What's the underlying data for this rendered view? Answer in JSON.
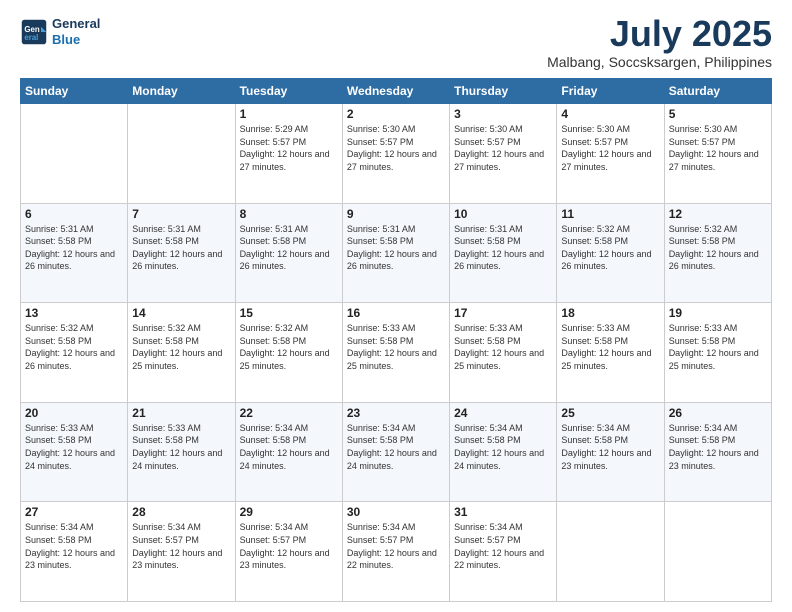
{
  "header": {
    "logo_line1": "General",
    "logo_line2": "Blue",
    "month": "July 2025",
    "location": "Malbang, Soccsksargen, Philippines"
  },
  "weekdays": [
    "Sunday",
    "Monday",
    "Tuesday",
    "Wednesday",
    "Thursday",
    "Friday",
    "Saturday"
  ],
  "weeks": [
    [
      {
        "day": "",
        "sunrise": "",
        "sunset": "",
        "daylight": ""
      },
      {
        "day": "",
        "sunrise": "",
        "sunset": "",
        "daylight": ""
      },
      {
        "day": "1",
        "sunrise": "Sunrise: 5:29 AM",
        "sunset": "Sunset: 5:57 PM",
        "daylight": "Daylight: 12 hours and 27 minutes."
      },
      {
        "day": "2",
        "sunrise": "Sunrise: 5:30 AM",
        "sunset": "Sunset: 5:57 PM",
        "daylight": "Daylight: 12 hours and 27 minutes."
      },
      {
        "day": "3",
        "sunrise": "Sunrise: 5:30 AM",
        "sunset": "Sunset: 5:57 PM",
        "daylight": "Daylight: 12 hours and 27 minutes."
      },
      {
        "day": "4",
        "sunrise": "Sunrise: 5:30 AM",
        "sunset": "Sunset: 5:57 PM",
        "daylight": "Daylight: 12 hours and 27 minutes."
      },
      {
        "day": "5",
        "sunrise": "Sunrise: 5:30 AM",
        "sunset": "Sunset: 5:57 PM",
        "daylight": "Daylight: 12 hours and 27 minutes."
      }
    ],
    [
      {
        "day": "6",
        "sunrise": "Sunrise: 5:31 AM",
        "sunset": "Sunset: 5:58 PM",
        "daylight": "Daylight: 12 hours and 26 minutes."
      },
      {
        "day": "7",
        "sunrise": "Sunrise: 5:31 AM",
        "sunset": "Sunset: 5:58 PM",
        "daylight": "Daylight: 12 hours and 26 minutes."
      },
      {
        "day": "8",
        "sunrise": "Sunrise: 5:31 AM",
        "sunset": "Sunset: 5:58 PM",
        "daylight": "Daylight: 12 hours and 26 minutes."
      },
      {
        "day": "9",
        "sunrise": "Sunrise: 5:31 AM",
        "sunset": "Sunset: 5:58 PM",
        "daylight": "Daylight: 12 hours and 26 minutes."
      },
      {
        "day": "10",
        "sunrise": "Sunrise: 5:31 AM",
        "sunset": "Sunset: 5:58 PM",
        "daylight": "Daylight: 12 hours and 26 minutes."
      },
      {
        "day": "11",
        "sunrise": "Sunrise: 5:32 AM",
        "sunset": "Sunset: 5:58 PM",
        "daylight": "Daylight: 12 hours and 26 minutes."
      },
      {
        "day": "12",
        "sunrise": "Sunrise: 5:32 AM",
        "sunset": "Sunset: 5:58 PM",
        "daylight": "Daylight: 12 hours and 26 minutes."
      }
    ],
    [
      {
        "day": "13",
        "sunrise": "Sunrise: 5:32 AM",
        "sunset": "Sunset: 5:58 PM",
        "daylight": "Daylight: 12 hours and 26 minutes."
      },
      {
        "day": "14",
        "sunrise": "Sunrise: 5:32 AM",
        "sunset": "Sunset: 5:58 PM",
        "daylight": "Daylight: 12 hours and 25 minutes."
      },
      {
        "day": "15",
        "sunrise": "Sunrise: 5:32 AM",
        "sunset": "Sunset: 5:58 PM",
        "daylight": "Daylight: 12 hours and 25 minutes."
      },
      {
        "day": "16",
        "sunrise": "Sunrise: 5:33 AM",
        "sunset": "Sunset: 5:58 PM",
        "daylight": "Daylight: 12 hours and 25 minutes."
      },
      {
        "day": "17",
        "sunrise": "Sunrise: 5:33 AM",
        "sunset": "Sunset: 5:58 PM",
        "daylight": "Daylight: 12 hours and 25 minutes."
      },
      {
        "day": "18",
        "sunrise": "Sunrise: 5:33 AM",
        "sunset": "Sunset: 5:58 PM",
        "daylight": "Daylight: 12 hours and 25 minutes."
      },
      {
        "day": "19",
        "sunrise": "Sunrise: 5:33 AM",
        "sunset": "Sunset: 5:58 PM",
        "daylight": "Daylight: 12 hours and 25 minutes."
      }
    ],
    [
      {
        "day": "20",
        "sunrise": "Sunrise: 5:33 AM",
        "sunset": "Sunset: 5:58 PM",
        "daylight": "Daylight: 12 hours and 24 minutes."
      },
      {
        "day": "21",
        "sunrise": "Sunrise: 5:33 AM",
        "sunset": "Sunset: 5:58 PM",
        "daylight": "Daylight: 12 hours and 24 minutes."
      },
      {
        "day": "22",
        "sunrise": "Sunrise: 5:34 AM",
        "sunset": "Sunset: 5:58 PM",
        "daylight": "Daylight: 12 hours and 24 minutes."
      },
      {
        "day": "23",
        "sunrise": "Sunrise: 5:34 AM",
        "sunset": "Sunset: 5:58 PM",
        "daylight": "Daylight: 12 hours and 24 minutes."
      },
      {
        "day": "24",
        "sunrise": "Sunrise: 5:34 AM",
        "sunset": "Sunset: 5:58 PM",
        "daylight": "Daylight: 12 hours and 24 minutes."
      },
      {
        "day": "25",
        "sunrise": "Sunrise: 5:34 AM",
        "sunset": "Sunset: 5:58 PM",
        "daylight": "Daylight: 12 hours and 23 minutes."
      },
      {
        "day": "26",
        "sunrise": "Sunrise: 5:34 AM",
        "sunset": "Sunset: 5:58 PM",
        "daylight": "Daylight: 12 hours and 23 minutes."
      }
    ],
    [
      {
        "day": "27",
        "sunrise": "Sunrise: 5:34 AM",
        "sunset": "Sunset: 5:58 PM",
        "daylight": "Daylight: 12 hours and 23 minutes."
      },
      {
        "day": "28",
        "sunrise": "Sunrise: 5:34 AM",
        "sunset": "Sunset: 5:57 PM",
        "daylight": "Daylight: 12 hours and 23 minutes."
      },
      {
        "day": "29",
        "sunrise": "Sunrise: 5:34 AM",
        "sunset": "Sunset: 5:57 PM",
        "daylight": "Daylight: 12 hours and 23 minutes."
      },
      {
        "day": "30",
        "sunrise": "Sunrise: 5:34 AM",
        "sunset": "Sunset: 5:57 PM",
        "daylight": "Daylight: 12 hours and 22 minutes."
      },
      {
        "day": "31",
        "sunrise": "Sunrise: 5:34 AM",
        "sunset": "Sunset: 5:57 PM",
        "daylight": "Daylight: 12 hours and 22 minutes."
      },
      {
        "day": "",
        "sunrise": "",
        "sunset": "",
        "daylight": ""
      },
      {
        "day": "",
        "sunrise": "",
        "sunset": "",
        "daylight": ""
      }
    ]
  ]
}
